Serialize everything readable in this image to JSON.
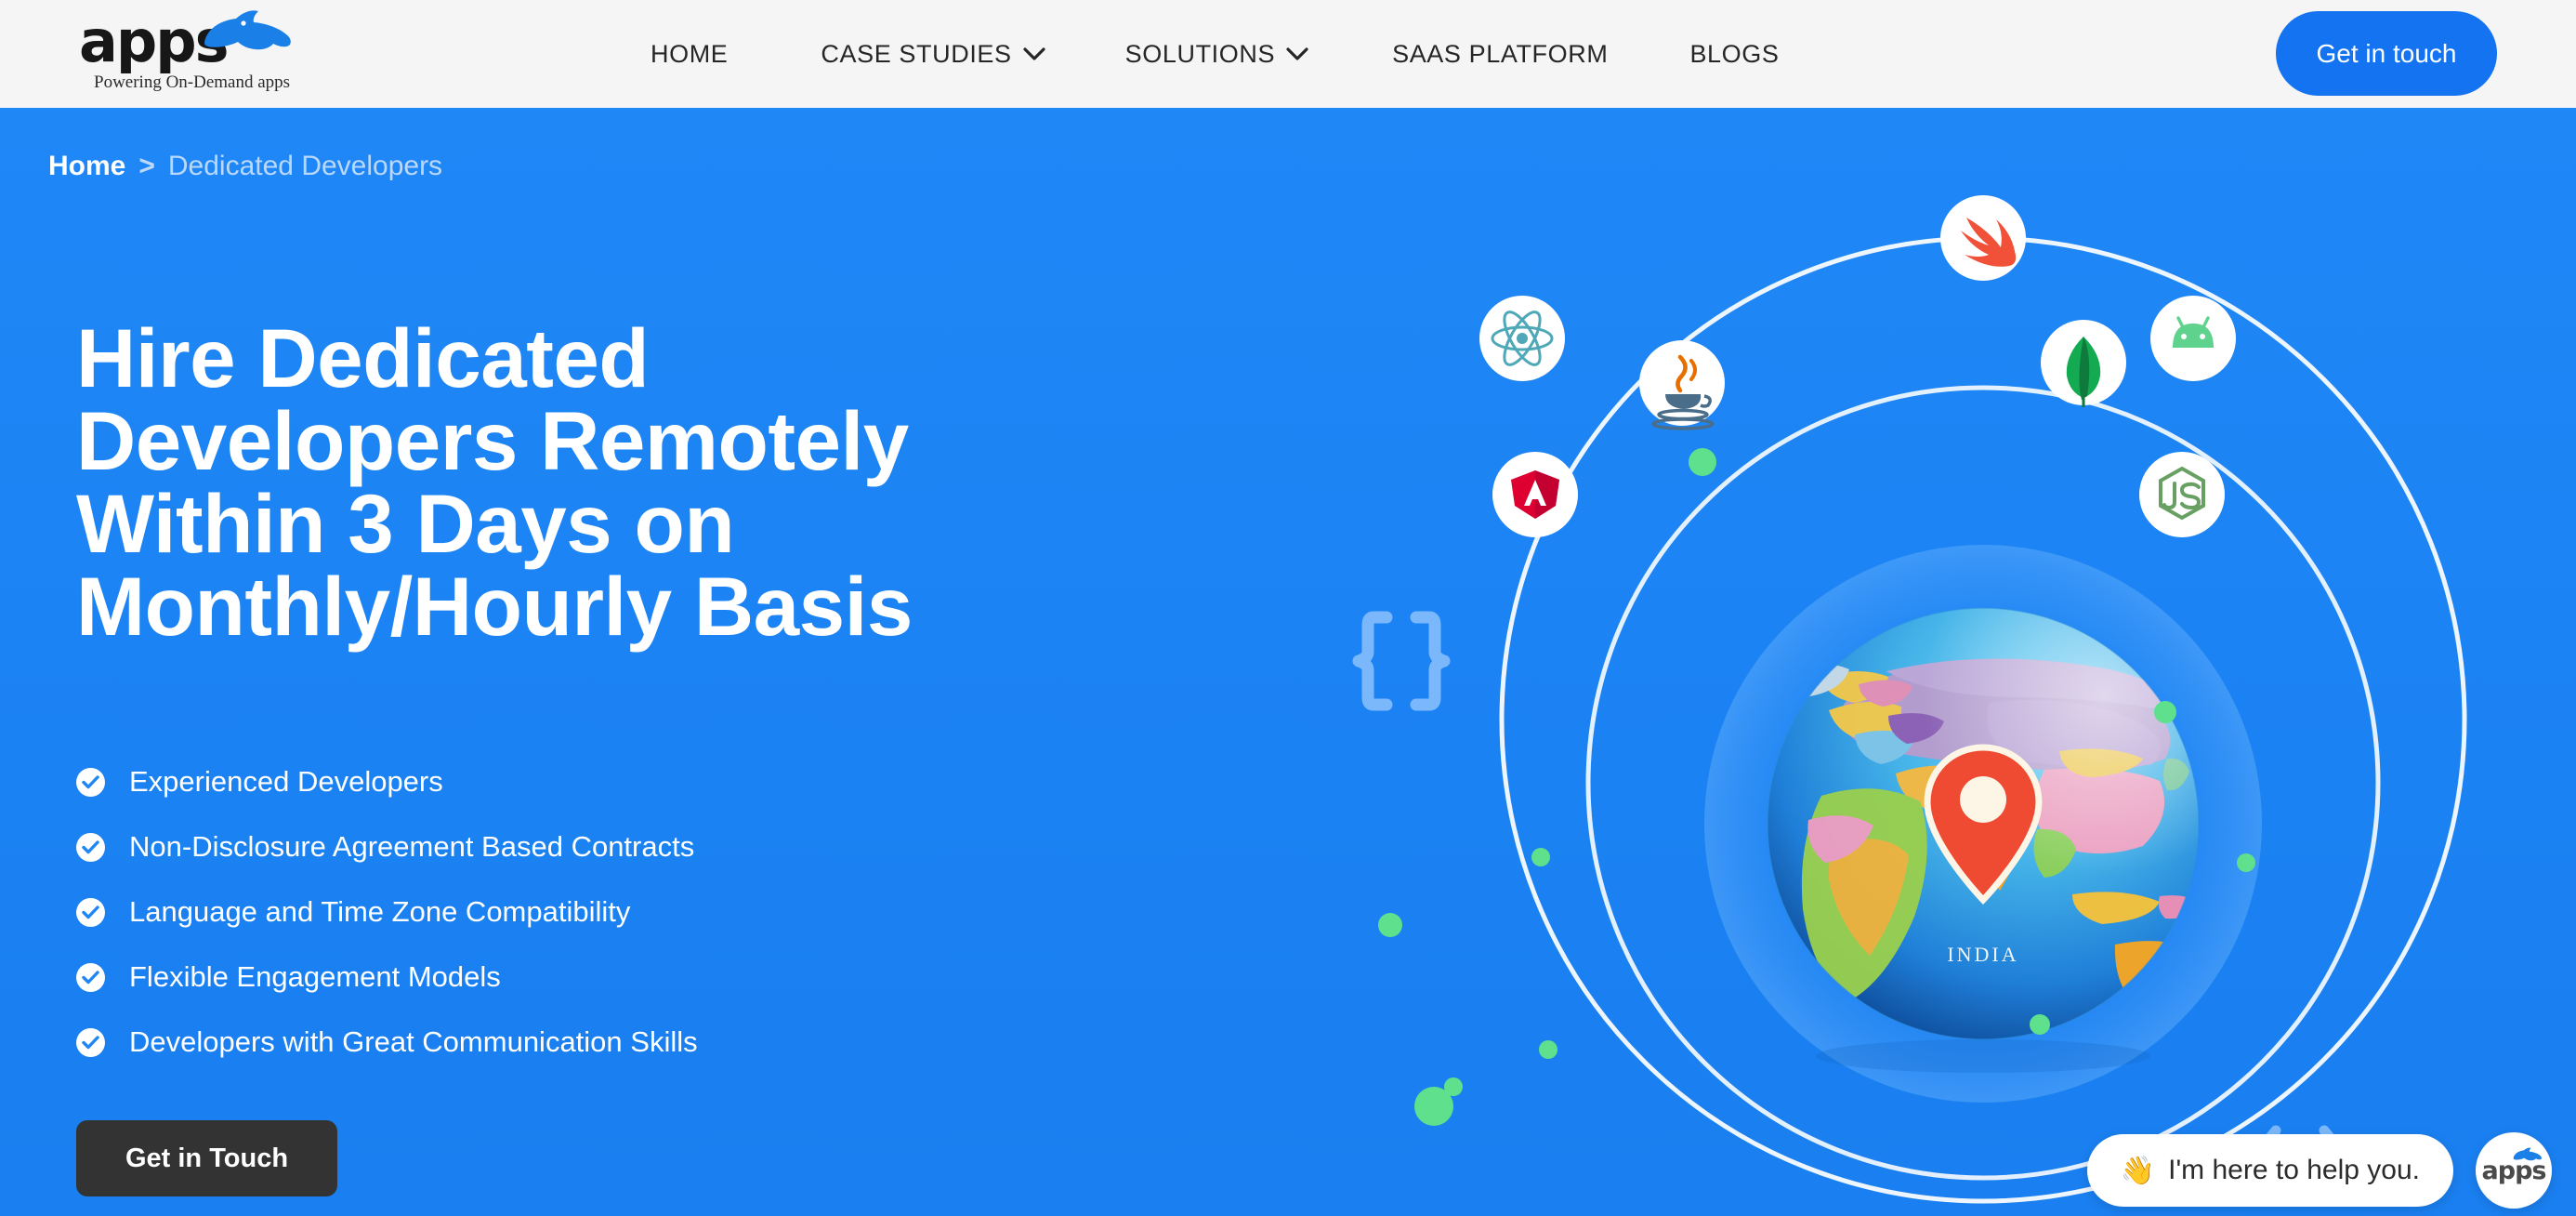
{
  "header": {
    "logo": {
      "word": "apps",
      "tagline": "Powering On-Demand apps",
      "icon": "rhino-icon"
    },
    "nav": [
      {
        "label": "HOME",
        "has_dropdown": false
      },
      {
        "label": "CASE STUDIES",
        "has_dropdown": true
      },
      {
        "label": "SOLUTIONS",
        "has_dropdown": true
      },
      {
        "label": "SAAS PLATFORM",
        "has_dropdown": false
      },
      {
        "label": "BLOGS",
        "has_dropdown": false
      }
    ],
    "cta_label": "Get in touch"
  },
  "hero": {
    "breadcrumb": {
      "home": "Home",
      "separator": ">",
      "current": "Dedicated Developers"
    },
    "headline": "Hire Dedicated Developers Remotely Within 3 Days on Monthly/Hourly Basis",
    "features": [
      "Experienced Developers",
      "Non-Disclosure Agreement Based Contracts",
      "Language and Time Zone Compatibility",
      "Flexible Engagement Models",
      "Developers with Great Communication Skills"
    ],
    "cta_label": "Get in Touch"
  },
  "illustration": {
    "globe_label": "INDIA",
    "pin_icon": "map-pin-icon",
    "decorations": [
      {
        "name": "curly-braces-icon",
        "glyph": "{ }"
      },
      {
        "name": "code-brackets-icon",
        "glyph": "<...>"
      }
    ],
    "tech_icons": [
      {
        "name": "swift-icon",
        "label": "Swift",
        "color": "#F05138"
      },
      {
        "name": "react-icon",
        "label": "React",
        "color": "#4FA8B8"
      },
      {
        "name": "java-icon",
        "label": "Java",
        "color": "#E76F00"
      },
      {
        "name": "mongodb-icon",
        "label": "MongoDB",
        "color": "#13AA52"
      },
      {
        "name": "android-icon",
        "label": "Android",
        "color": "#5FD38D"
      },
      {
        "name": "angular-icon",
        "label": "Angular",
        "color": "#DD0031"
      },
      {
        "name": "nodejs-icon",
        "label": "Node.js",
        "color": "#68A063"
      }
    ],
    "accent_dot_color": "#5FE08C"
  },
  "chat": {
    "emoji": "👋",
    "message": "I'm here to help you.",
    "avatar_word": "apps"
  },
  "colors": {
    "hero_blue": "#1E86F5",
    "header_bg": "#F5F5F5",
    "cta_blue": "#1373F0",
    "cta_dark": "#333333",
    "accent_green": "#5FE08C"
  }
}
